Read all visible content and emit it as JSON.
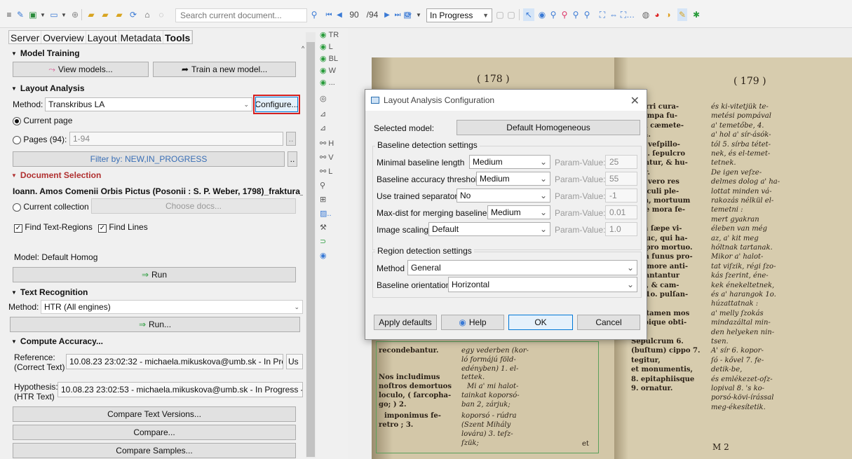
{
  "toolbar": {
    "search_placeholder": "Search current document...",
    "page_current": "90",
    "page_total": "/94",
    "status_value": "In Progress"
  },
  "left": {
    "tabs": [
      "Server",
      "Overview",
      "Layout",
      "Metadata",
      "Tools"
    ],
    "active_tab": "Tools",
    "model_training": {
      "title": "Model Training",
      "view_models": "View models...",
      "train_new": "Train a new model..."
    },
    "layout_analysis": {
      "title": "Layout Analysis",
      "method_label": "Method:",
      "method_value": "Transkribus LA",
      "configure": "Configure...",
      "current_page": "Current page",
      "pages_label": "Pages (94):",
      "pages_value": "1-94",
      "filter": "Filter by: NEW,IN_PROGRESS"
    },
    "doc_selection": {
      "title": "Document Selection",
      "doc_title": "Ioann. Amos Comenii Orbis Pictus (Posonii : S. P. Weber, 1798)_fraktura_nem",
      "current_collection": "Current collection",
      "choose_docs": "Choose docs...",
      "find_regions": "Find Text-Regions",
      "find_lines": "Find Lines",
      "model": "Model: Default Homog",
      "run": "Run"
    },
    "text_recognition": {
      "title": "Text Recognition",
      "method_label": "Method:",
      "method_value": "HTR (All engines)",
      "run": "Run..."
    },
    "compute_accuracy": {
      "title": "Compute Accuracy...",
      "reference_label": "Reference:",
      "reference_sub": "(Correct Text)",
      "reference_value": "10.08.23 23:02:32 - michaela.mikuskova@umb.sk - In Progress",
      "reference_extra": "Us",
      "hypothesis_label": "Hypothesis:",
      "hypothesis_sub": "(HTR Text)",
      "hypothesis_value": "10.08.23 23:02:53 - michaela.mikuskova@umb.sk - In Progress - Transk",
      "compare_versions": "Compare Text Versions...",
      "compare": "Compare...",
      "compare_samples": "Compare Samples..."
    }
  },
  "icon_column": {
    "labels": [
      "TR",
      "L",
      "BL",
      "W",
      "..."
    ]
  },
  "dialog": {
    "title": "Layout Analysis Configuration",
    "selected_model_label": "Selected model:",
    "selected_model_value": "Default Homogeneous",
    "baseline_group": "Baseline detection settings",
    "param_label": "Param-Value:",
    "rows": [
      {
        "label": "Minimal baseline length",
        "value": "Medium",
        "param": "25"
      },
      {
        "label": "Baseline accuracy threshold",
        "value": "Medium",
        "param": "55"
      },
      {
        "label": "Use trained separators",
        "value": "No",
        "param": "-1"
      },
      {
        "label": "Max-dist for merging baselines",
        "value": "Medium",
        "param": "0.01"
      },
      {
        "label": "Image scaling",
        "value": "Default",
        "param": "1.0"
      }
    ],
    "region_group": "Region detection settings",
    "method_label": "Method",
    "method_value": "General",
    "orientation_label": "Baseline orientation",
    "orientation_value": "Horizontal",
    "apply_defaults": "Apply defaults",
    "help": "Help",
    "ok": "OK",
    "cancel": "Cancel"
  },
  "document_image": {
    "left_heading": "( 178 )",
    "right_heading": "( 179 )",
    "left_lines": [
      "recondebantur.",
      "Nos includimus",
      "noſtros demortuos",
      "loculo, ( ſarcopha-",
      "go; ) 2.",
      "imponimus fe-",
      "retro ; 3."
    ],
    "left_lines_b": [
      "egy vederben (kor-",
      "ló formájú föld-",
      "edényben) 1. el-",
      "tettek.",
      "Mi a' mi halot-",
      "tainkat koporsó-",
      "ban 2, zárjuk;",
      "koporsó - rúdra",
      "(Szent Mihály",
      "lovára) 3. teſz-",
      "ſzük;"
    ],
    "right_lines_a": [
      "efferri cura-",
      "s pompa fu-",
      "ri in cæmete-",
      "m, 4.",
      "bi a veſpillo-",
      "us 5. ſepulcro",
      "eruntur, & hu-",
      "ntur.",
      "Sed vero res",
      "periculi ple-",
      "ſima, mortuum",
      "sque mora fe-",
      "ire :",
      "nam ſæpe vi-",
      "adhuc, qui ha-",
      "tur pro mortuo.",
      "Cum funus pro-",
      "dit, more anti-",
      "o, cantantur",
      "mni, & cam-",
      "næ 1o. pulſan-",
      ":",
      "qui tamen mos",
      "n ubique obti-",
      "t.",
      "Sepulcrum 6.",
      "(buſtum) cippo 7.",
      "tegitur,",
      "et monumentis,",
      "8. epitaphiisque",
      "9. ornatur."
    ],
    "right_lines_b": [
      "és ki-vitetjük te-",
      "metési pompával",
      "a' temetőbe, 4.",
      "a' hol a' sír-ásók-",
      "tól 5. sírba tétet-",
      "nek, és el-temet-",
      "tetnek.",
      "De igen veſze-",
      "delmes dolog a' ha-",
      "lottat minden vá-",
      "rakozás nélkül el-",
      "temetni :",
      "mert gyakran",
      "éleben van még",
      "az, a' kit meg",
      "hóltnak tartanak.",
      "Mikor a' halot-",
      "tat viſzik, régi ſzo-",
      "kás ſzerint, éne-",
      "kek énekeltetnek,",
      "és a' harangok 1o.",
      "húzattatnak :",
      "a' melly ſzokás",
      "mindazáltal min-",
      "den helyeken nin-",
      "tsen.",
      "A' sír 6. kopor-",
      "ſó - kővel 7. fe-",
      "detik-be,",
      "és emlékezet-oſz-",
      "lopival 8. 's ko-",
      "porsó-kövi-írással",
      "meg-ékesítetik."
    ],
    "right_footer": "M 2",
    "left_footer": "et"
  }
}
